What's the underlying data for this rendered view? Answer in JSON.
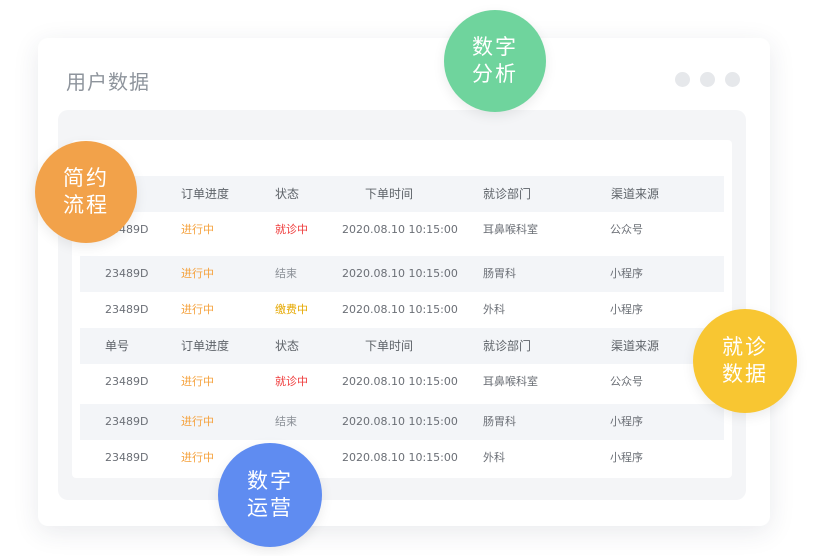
{
  "window": {
    "title": "用户数据"
  },
  "table": {
    "headers": [
      "订单进度",
      "状态",
      "下单时间",
      "就诊部门",
      "渠道来源"
    ],
    "headers_full": [
      "单号",
      "订单进度",
      "状态",
      "下单时间",
      "就诊部门",
      "渠道来源"
    ],
    "rows": [
      [
        "23489D",
        "进行中",
        "就诊中",
        "2020.08.10  10:15:00",
        "耳鼻喉科室",
        "公众号"
      ],
      [
        "23489D",
        "进行中",
        "结束",
        "2020.08.10  10:15:00",
        "肠胃科",
        "小程序"
      ],
      [
        "23489D",
        "进行中",
        "缴费中",
        "2020.08.10  10:15:00",
        "外科",
        "小程序"
      ],
      [
        "23489D",
        "进行中",
        "就诊中",
        "2020.08.10  10:15:00",
        "耳鼻喉科室",
        "公众号"
      ],
      [
        "23489D",
        "进行中",
        "结束",
        "2020.08.10  10:15:00",
        "肠胃科",
        "小程序"
      ],
      [
        "23489D",
        "进行中",
        "",
        "2020.08.10  10:15:00",
        "外科",
        "小程序"
      ]
    ]
  },
  "bubbles": {
    "green": [
      "数字",
      "分析"
    ],
    "orange": [
      "简约",
      "流程"
    ],
    "yellow": [
      "就诊",
      "数据"
    ],
    "blue": [
      "数字",
      "运营"
    ]
  },
  "colors": {
    "in_progress": "#f5a13b",
    "visiting": "#ef3b3b",
    "paying": "#e6a800",
    "bubble_green": "#6fd49d",
    "bubble_orange": "#f2a24a",
    "bubble_yellow": "#f8c632",
    "bubble_blue": "#5f8cf1"
  }
}
